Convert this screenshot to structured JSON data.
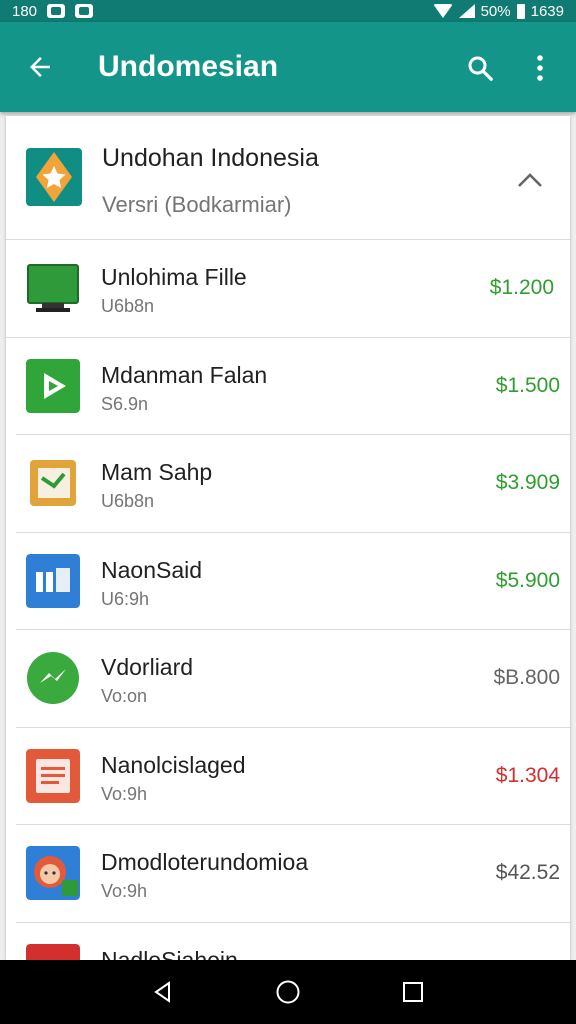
{
  "status_bar": {
    "time_left": "180",
    "battery": "50%",
    "clock": "1639"
  },
  "app_bar": {
    "title": "Undomesian",
    "back_icon": "arrow-back-icon",
    "search_icon": "search-icon",
    "more_icon": "more-vert-icon"
  },
  "header": {
    "title": "Undohan Indonesia",
    "subtitle": "Versri (Bodkarmiar)",
    "icon": "app-star-icon",
    "collapse_icon": "chevron-up-icon"
  },
  "items": [
    {
      "title": "Unlohima Fille",
      "sub": "U6b8n",
      "price": "$1.200",
      "price_color": "#2e9e2e",
      "icon": "monitor-icon",
      "icon_bg": "#2f9a3a"
    },
    {
      "title": "Mdanman Falan",
      "sub": "S6.9n",
      "price": "$1.500",
      "price_color": "#2e9e2e",
      "icon": "play-icon",
      "icon_bg": "#2fa53a"
    },
    {
      "title": "Mam Sahp",
      "sub": "U6b8n",
      "price": "$3.909",
      "price_color": "#2e9e2e",
      "icon": "document-icon",
      "icon_bg": "#e0a43a"
    },
    {
      "title": "NaonSaid",
      "sub": "U6:9h",
      "price": "$5.900",
      "price_color": "#2e9e2e",
      "icon": "panel-icon",
      "icon_bg": "#2f7fd6"
    },
    {
      "title": "Vdorliard",
      "sub": "Vo:on",
      "price": "$B.800",
      "price_color": "#666666",
      "icon": "messenger-icon",
      "icon_bg": "#3aaa3f"
    },
    {
      "title": "Nanolcislaged",
      "sub": "Vo:9h",
      "price": "$1.304",
      "price_color": "#d32f2f",
      "icon": "notes-icon",
      "icon_bg": "#e25a3a"
    },
    {
      "title": "Dmodloterundomioa",
      "sub": "Vo:9h",
      "price": "$42.52",
      "price_color": "#555555",
      "icon": "avatar-icon",
      "icon_bg": "#2f7fd6"
    },
    {
      "title": "NadloSiahoin",
      "sub": "",
      "price": "",
      "price_color": "#555555",
      "icon": "red-app-icon",
      "icon_bg": "#d32f2f"
    }
  ],
  "nav_bar": {
    "back": "nav-back-icon",
    "home": "nav-home-icon",
    "recents": "nav-recents-icon"
  }
}
